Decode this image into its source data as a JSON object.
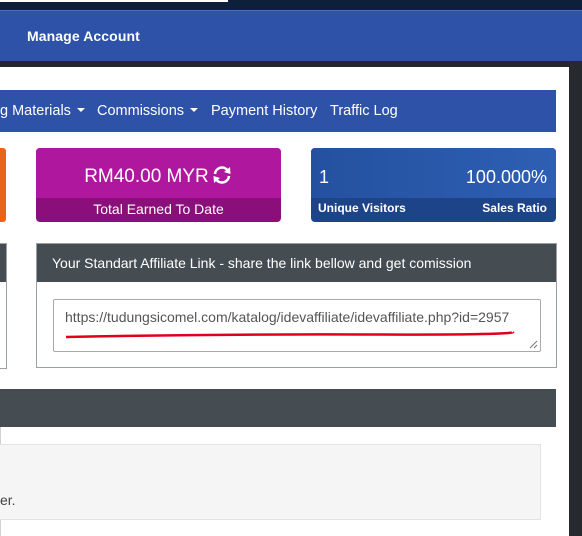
{
  "header": {
    "manage_account": "Manage Account"
  },
  "nav": {
    "items": [
      {
        "label": "g Materials",
        "dropdown": true
      },
      {
        "label": "Commissions",
        "dropdown": true
      },
      {
        "label": "Payment History",
        "dropdown": false
      },
      {
        "label": "Traffic Log",
        "dropdown": false
      }
    ]
  },
  "stats": {
    "earned": {
      "amount": "RM40.00 MYR",
      "caption": "Total Earned To Date",
      "icon": "refresh-icon"
    },
    "visitors": {
      "count": "1",
      "count_label": "Unique Visitors",
      "ratio": "100.000%",
      "ratio_label": "Sales Ratio"
    }
  },
  "affiliate": {
    "heading": "Your Standart Affiliate Link - share the link bellow and get comission",
    "link": "https://tudungsicomel.com/katalog/idevaffiliate/idevaffiliate.php?id=2957"
  },
  "bottom": {
    "row_text": "er."
  },
  "colors": {
    "brand_blue": "#2d52a8",
    "magenta": "#b0179f",
    "panel_header": "#454c52",
    "highlight_red": "#e0001b"
  }
}
